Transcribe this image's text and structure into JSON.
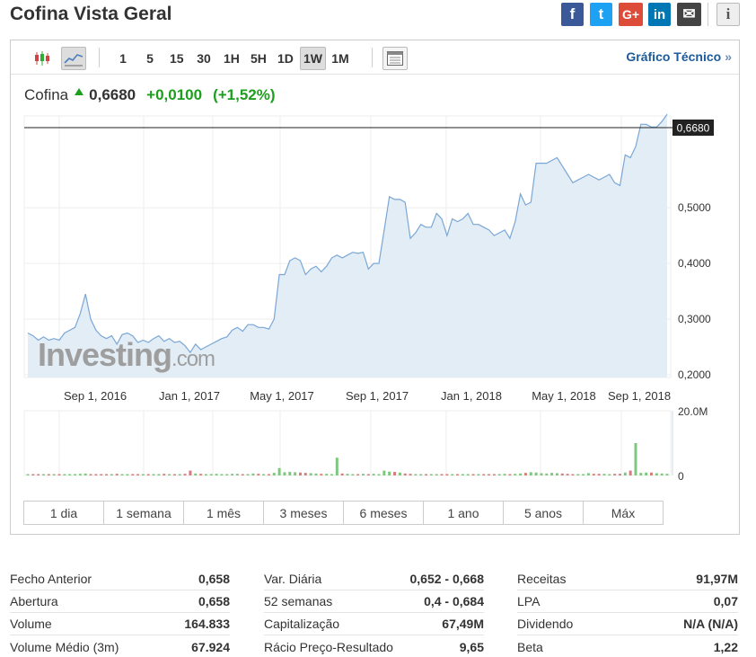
{
  "title": "Cofina Vista Geral",
  "share_icons": [
    {
      "name": "facebook-icon",
      "glyph": "f"
    },
    {
      "name": "twitter-icon",
      "glyph": "t"
    },
    {
      "name": "google-plus-icon",
      "glyph": "G+"
    },
    {
      "name": "linkedin-icon",
      "glyph": "in"
    },
    {
      "name": "email-icon",
      "glyph": "✉"
    },
    {
      "name": "info-icon",
      "glyph": "i"
    }
  ],
  "toolbar": {
    "intervals": [
      "1",
      "5",
      "15",
      "30",
      "1H",
      "5H",
      "1D",
      "1W",
      "1M"
    ],
    "active_interval": "1W",
    "technical_link": "Gráfico Técnico",
    "technical_arrow": "»"
  },
  "quote": {
    "name": "Cofina",
    "price": "0,6680",
    "change": "+0,0100",
    "change_pct": "(+1,52%)",
    "direction": "up",
    "up_color": "#1e9e1e"
  },
  "chart_data": {
    "type": "area",
    "watermark": {
      "brand": "Investing",
      "suffix": ".com"
    },
    "current_price_label": "0,6680",
    "current_price": 0.668,
    "x_tick_labels": [
      "Sep 1, 2016",
      "Jan 1, 2017",
      "May 1, 2017",
      "Sep 1, 2017",
      "Jan 1, 2018",
      "May 1, 2018",
      "Sep 1, 2018"
    ],
    "y_tick_labels": [
      "0,5000",
      "0,4000",
      "0,3000",
      "0,2000"
    ],
    "y_ticks": [
      0.5,
      0.4,
      0.3,
      0.2
    ],
    "ylim": [
      0.195,
      0.665
    ],
    "volume_tick_labels": [
      "20.0M",
      "0"
    ],
    "volume_max": 20000000,
    "line_color": "#7aa7d6",
    "fill_color": "#e3edf6",
    "series": [
      {
        "values": [
          0.275,
          0.27,
          0.262,
          0.268,
          0.262,
          0.265,
          0.262,
          0.275,
          0.28,
          0.285,
          0.31,
          0.345,
          0.3,
          0.28,
          0.27,
          0.265,
          0.27,
          0.255,
          0.272,
          0.275,
          0.27,
          0.258,
          0.262,
          0.258,
          0.265,
          0.27,
          0.26,
          0.265,
          0.258,
          0.26,
          0.252,
          0.24,
          0.255,
          0.245,
          0.25,
          0.255,
          0.26,
          0.265,
          0.268,
          0.28,
          0.285,
          0.278,
          0.29,
          0.29,
          0.285,
          0.285,
          0.282,
          0.3,
          0.38,
          0.38,
          0.405,
          0.41,
          0.405,
          0.38,
          0.39,
          0.395,
          0.385,
          0.395,
          0.41,
          0.415,
          0.41,
          0.415,
          0.42,
          0.418,
          0.42,
          0.39,
          0.4,
          0.4,
          0.46,
          0.52,
          0.515,
          0.515,
          0.51,
          0.445,
          0.455,
          0.47,
          0.465,
          0.465,
          0.49,
          0.48,
          0.45,
          0.48,
          0.475,
          0.48,
          0.49,
          0.47,
          0.47,
          0.465,
          0.46,
          0.45,
          0.455,
          0.46,
          0.445,
          0.475,
          0.525,
          0.505,
          0.51,
          0.58,
          0.58,
          0.58,
          0.585,
          0.59,
          0.575,
          0.56,
          0.545,
          0.55,
          0.555,
          0.56,
          0.555,
          0.55,
          0.555,
          0.56,
          0.545,
          0.54,
          0.595,
          0.59,
          0.61,
          0.65,
          0.65,
          0.645,
          0.645,
          0.655,
          0.668
        ]
      }
    ],
    "volume_series": [
      {
        "values": [
          0.3,
          0.2,
          0.3,
          0.2,
          0.3,
          0.4,
          0.3,
          0.2,
          0.3,
          0.3,
          0.5,
          0.6,
          0.4,
          0.3,
          0.4,
          0.3,
          0.3,
          0.5,
          0.3,
          0.3,
          0.2,
          0.3,
          0.3,
          0.2,
          0.3,
          0.4,
          0.5,
          0.4,
          0.3,
          0.4,
          0.5,
          1.5,
          0.6,
          0.5,
          0.4,
          0.3,
          0.5,
          0.4,
          0.4,
          0.5,
          0.5,
          0.4,
          0.4,
          0.6,
          0.5,
          0.4,
          0.4,
          0.8,
          2.3,
          1.0,
          1.1,
          1.0,
          0.9,
          0.8,
          0.7,
          0.6,
          0.5,
          0.5,
          0.4,
          5.5,
          0.6,
          0.5,
          0.4,
          0.4,
          0.5,
          0.4,
          0.5,
          0.3,
          1.5,
          1.2,
          1.1,
          0.9,
          0.6,
          0.5,
          0.4,
          0.4,
          0.3,
          0.3,
          0.4,
          0.3,
          0.3,
          0.3,
          0.4,
          0.3,
          0.3,
          0.3,
          0.3,
          0.4,
          0.3,
          0.3,
          0.4,
          0.5,
          0.4,
          0.5,
          0.6,
          0.8,
          1.0,
          0.9,
          0.7,
          0.6,
          0.8,
          0.7,
          0.6,
          0.5,
          0.4,
          0.4,
          0.4,
          0.7,
          0.5,
          0.5,
          0.5,
          0.4,
          0.5,
          0.5,
          0.9,
          1.5,
          10.0,
          0.8,
          0.9,
          0.9,
          0.7,
          0.6,
          0.5
        ]
      }
    ],
    "volume_colors": {
      "up": "#7fc77f",
      "down": "#d87d7d"
    }
  },
  "ranges": [
    "1 dia",
    "1 semana",
    "1 mês",
    "3 meses",
    "6 meses",
    "1 ano",
    "5 anos",
    "Máx"
  ],
  "stats": {
    "col1": [
      {
        "label": "Fecho Anterior",
        "value": "0,658"
      },
      {
        "label": "Abertura",
        "value": "0,658"
      },
      {
        "label": "Volume",
        "value": "164.833"
      },
      {
        "label": "Volume Médio (3m)",
        "value": "67.924"
      }
    ],
    "col2": [
      {
        "label": "Var. Diária",
        "value": "0,652 - 0,668"
      },
      {
        "label": "52 semanas",
        "value": "0,4 - 0,684"
      },
      {
        "label": "Capitalização",
        "value": "67,49M"
      },
      {
        "label": "Rácio Preço-Resultado",
        "value": "9,65"
      }
    ],
    "col3": [
      {
        "label": "Receitas",
        "value": "91,97M"
      },
      {
        "label": "LPA",
        "value": "0,07"
      },
      {
        "label": "Dividendo",
        "value": "N/A (N/A)"
      },
      {
        "label": "Beta",
        "value": "1,22"
      }
    ]
  }
}
